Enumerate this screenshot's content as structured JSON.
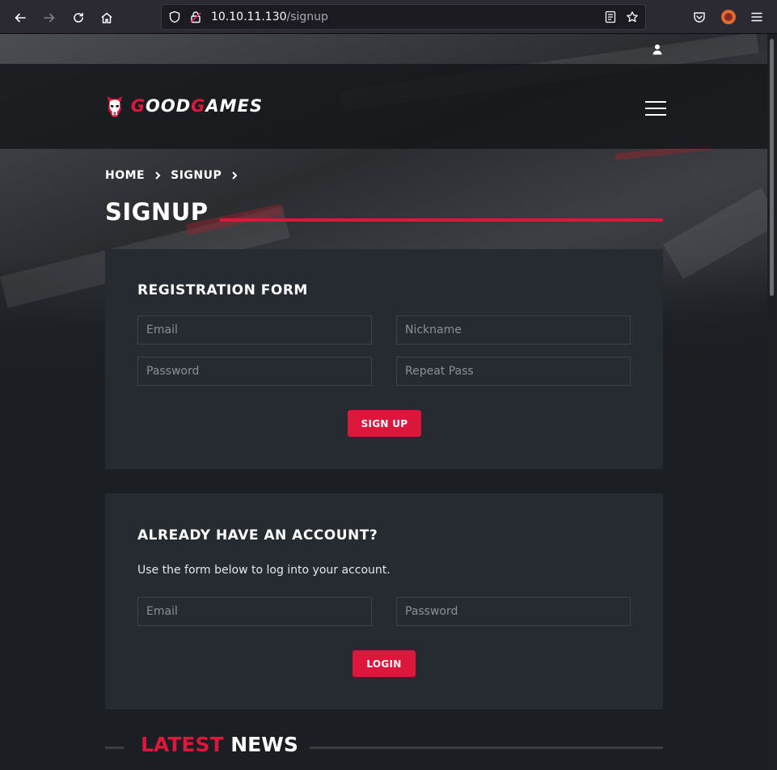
{
  "browser": {
    "url_host": "10.10.11.130",
    "url_path": "/signup"
  },
  "colors": {
    "accent": "#dd163b",
    "card_bg": "#262a31",
    "page_bg": "#1b1e22"
  },
  "icons": {
    "back": "arrow-left-icon",
    "forward": "arrow-right-icon",
    "reload": "reload-icon",
    "home": "home-icon",
    "shield": "shield-icon",
    "lock": "lock-icon",
    "reader": "reader-view-icon",
    "bookmark": "star-icon",
    "pocket": "pocket-icon",
    "extension": "extension-icon",
    "app_menu": "hamburger-icon",
    "user": "user-icon",
    "nav_menu": "hamburger-icon"
  },
  "header": {
    "logo_first": "G",
    "logo_mid": "OOD",
    "logo_g2": "G",
    "logo_rest": "AMES"
  },
  "breadcrumb": {
    "items": [
      "HOME",
      "SIGNUP"
    ]
  },
  "page_title": "SIGNUP",
  "registration": {
    "title": "REGISTRATION FORM",
    "email_placeholder": "Email",
    "nickname_placeholder": "Nickname",
    "password_placeholder": "Password",
    "repeat_placeholder": "Repeat Pass",
    "submit_label": "SIGN UP"
  },
  "login": {
    "title": "ALREADY HAVE AN ACCOUNT?",
    "description": "Use the form below to log into your account.",
    "email_placeholder": "Email",
    "password_placeholder": "Password",
    "submit_label": "LOGIN"
  },
  "news": {
    "accent_word": "LATEST",
    "word": "NEWS"
  }
}
